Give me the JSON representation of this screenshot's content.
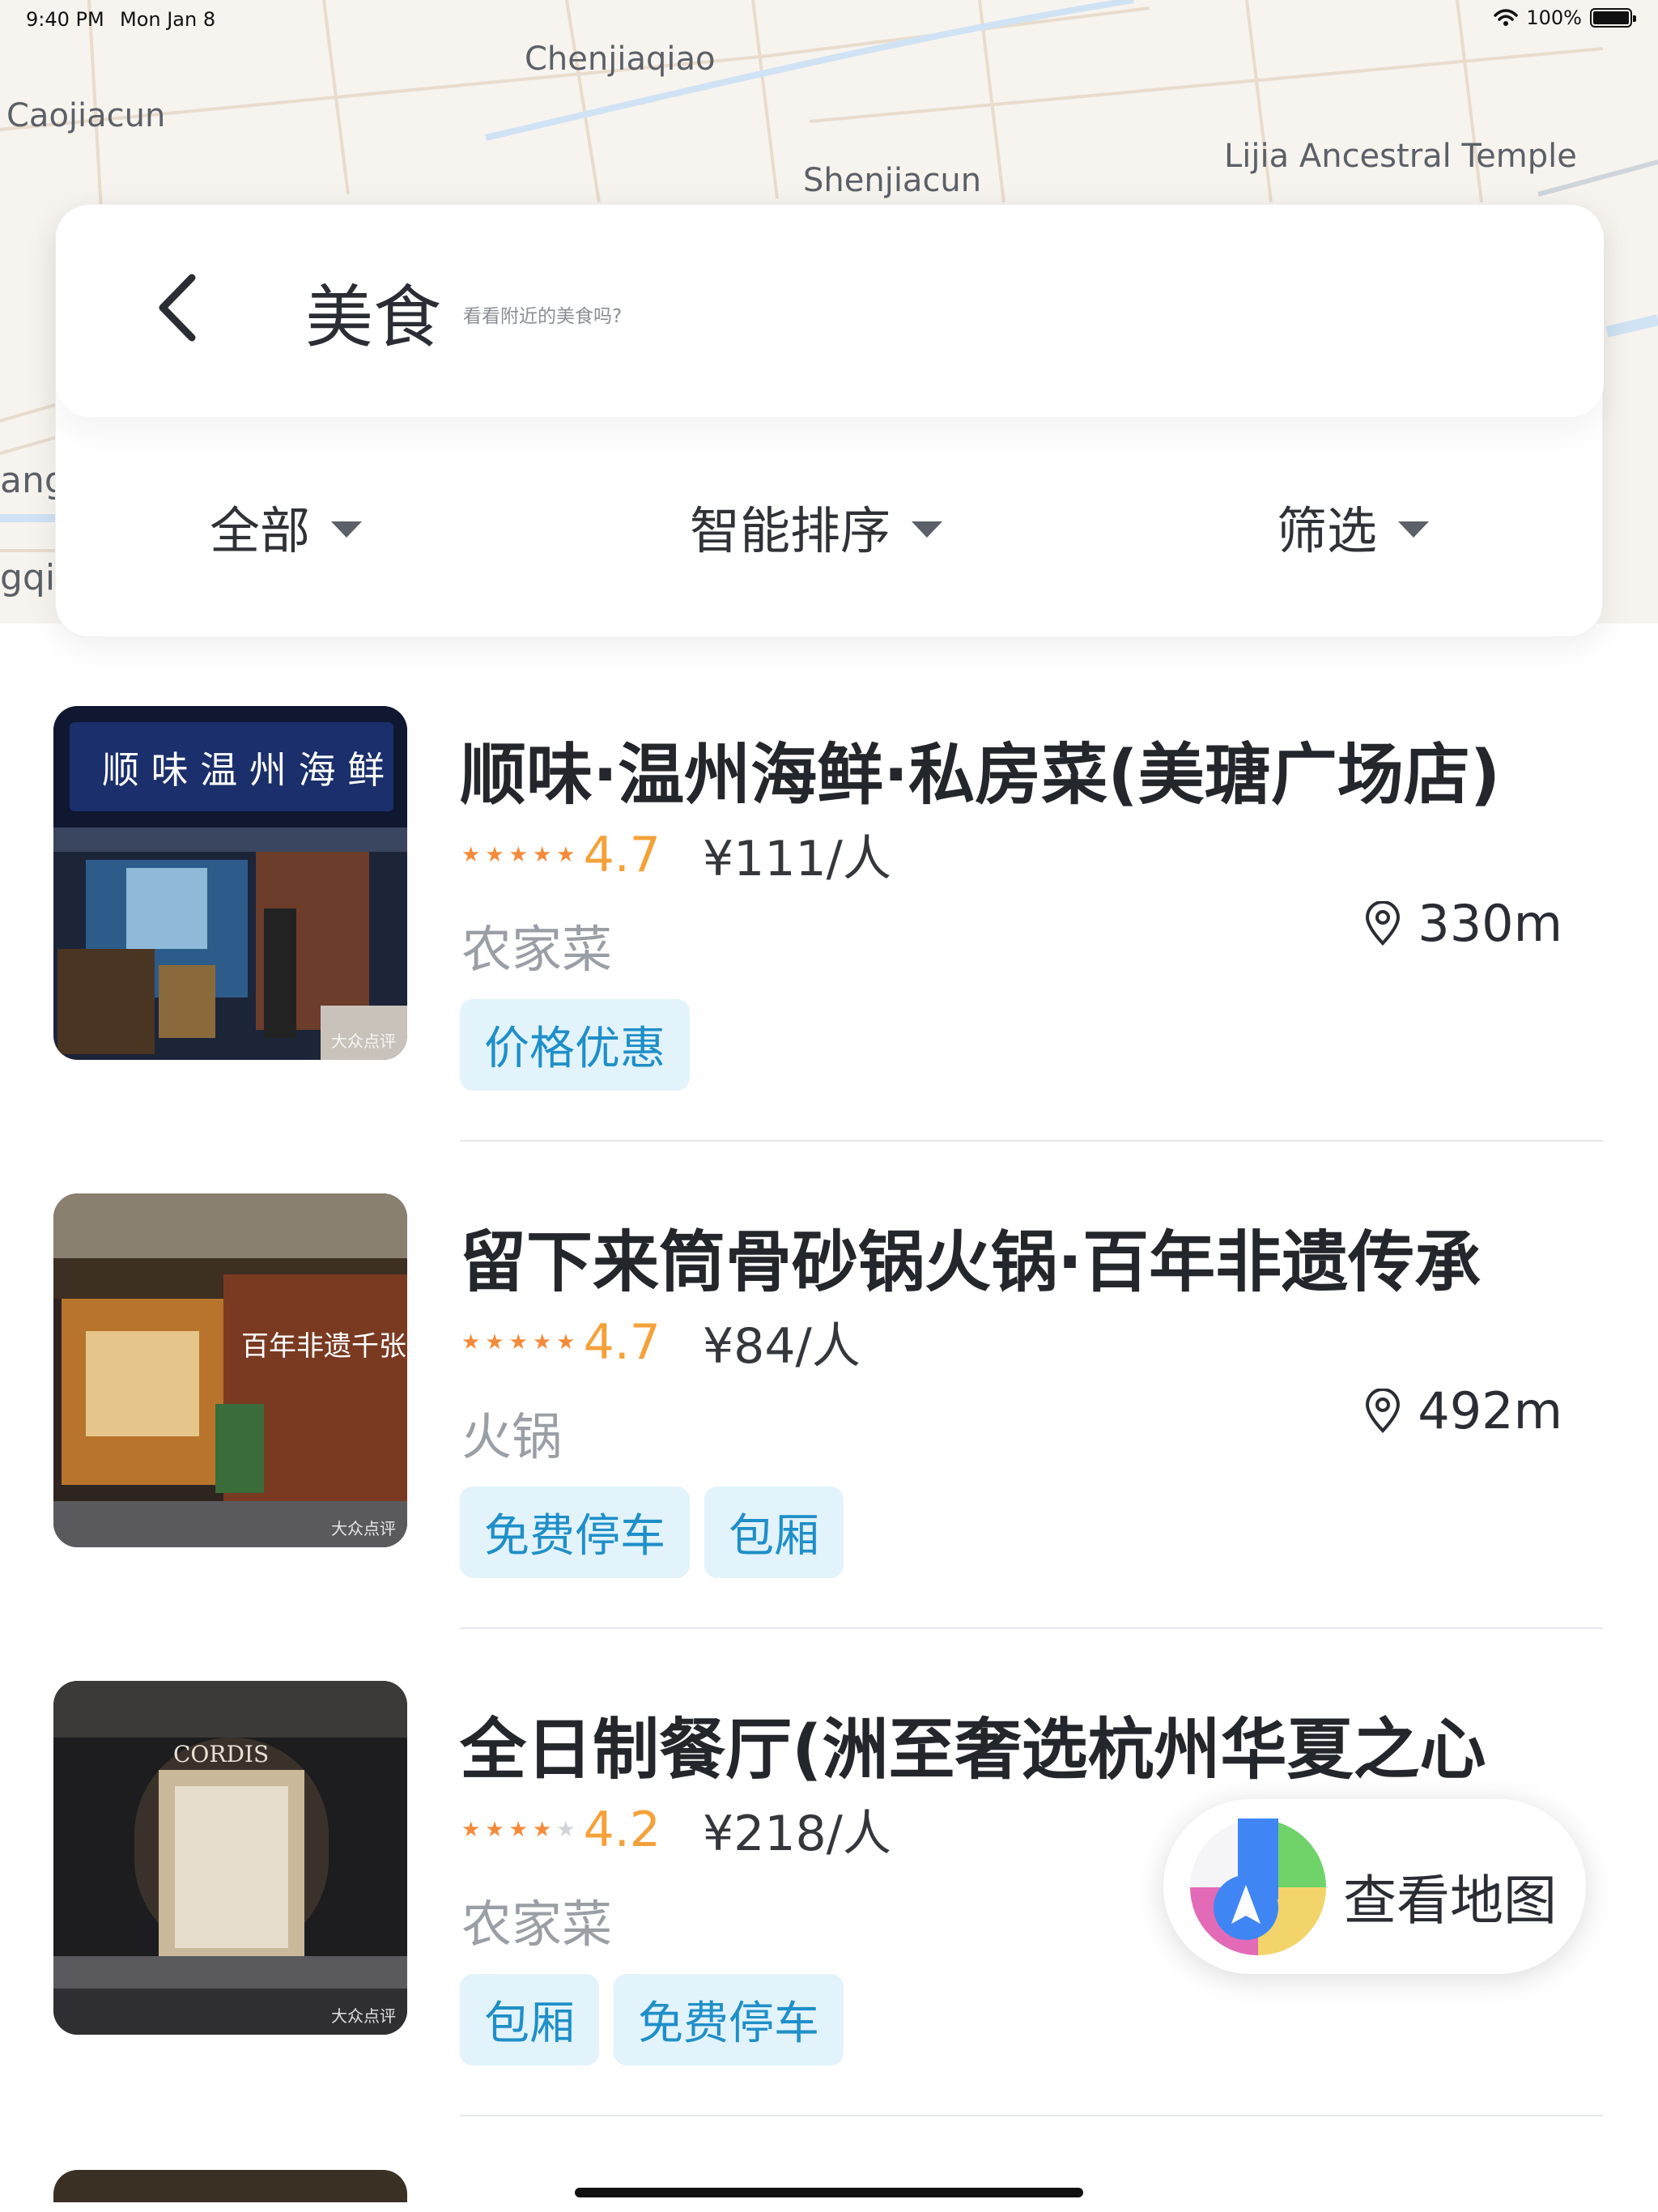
{
  "status_bar": {
    "time": "9:40 PM",
    "date": "Mon Jan 8",
    "battery": "100%"
  },
  "map": {
    "labels": [
      "Chenjiaqiao",
      "Caojiacun",
      "Shenjiacun",
      "Lijia Ancestral Temple",
      "angt",
      "gqia"
    ]
  },
  "header": {
    "title": "美食",
    "subtitle": "看看附近的美食吗?"
  },
  "filters": [
    {
      "label": "全部"
    },
    {
      "label": "智能排序"
    },
    {
      "label": "筛选"
    }
  ],
  "restaurants": [
    {
      "name": "顺味·温州海鲜·私房菜(美瑭广场店)",
      "stars": 4.7,
      "rating": "4.7",
      "price": "¥111/人",
      "category": "农家菜",
      "distance": "330m",
      "tags": [
        "价格优惠"
      ],
      "image_text": "顺 味 温 州 海 鲜",
      "watermark": "大众点评"
    },
    {
      "name": "留下来筒骨砂锅火锅·百年非遗传承",
      "stars": 4.7,
      "rating": "4.7",
      "price": "¥84/人",
      "category": "火锅",
      "distance": "492m",
      "tags": [
        "免费停车",
        "包厢"
      ],
      "image_text": "百年非遗千张 啃啃筒骨更香",
      "watermark": "大众点评"
    },
    {
      "name": "全日制餐厅(洲至奢选杭州华夏之心",
      "stars": 4.2,
      "rating": "4.2",
      "price": "¥218/人",
      "category": "农家菜",
      "distance": "",
      "tags": [
        "包厢",
        "免费停车"
      ],
      "image_text": "CORDIS",
      "watermark": "大众点评"
    }
  ],
  "floating_button": {
    "label": "查看地图",
    "icon": "map-navigation-icon"
  },
  "colors": {
    "accent_tag_bg": "#e2f3fb",
    "accent_tag_text": "#1f8fc9",
    "rating": "#f5a13a"
  }
}
